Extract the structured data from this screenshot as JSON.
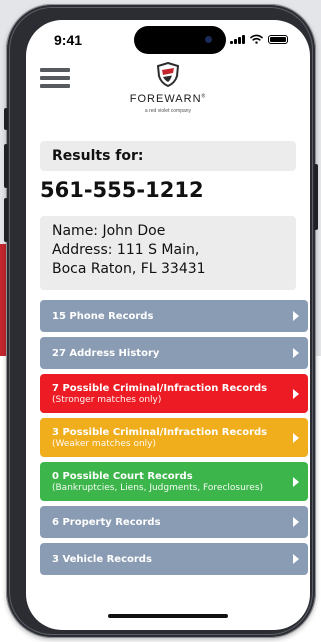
{
  "status_bar": {
    "time": "9:41"
  },
  "brand": {
    "name": "FOREWARN",
    "registered": "®",
    "tagline": "a red violet company",
    "colors": {
      "red": "#c4262e",
      "dark": "#2c2c2c"
    }
  },
  "results": {
    "heading": "Results for:",
    "phone": "561-555-1212",
    "name_line": "Name: John Doe",
    "address_line1": "Address: 111 S Main,",
    "address_line2": "Boca Raton, FL 33431"
  },
  "records": [
    {
      "title": "15 Phone Records",
      "subtitle": "",
      "color": "#8a9cb3"
    },
    {
      "title": "27 Address History",
      "subtitle": "",
      "color": "#8a9cb3"
    },
    {
      "title": "7 Possible Criminal/Infraction Records",
      "subtitle": "(Stronger matches only)",
      "color": "#ed1c24"
    },
    {
      "title": "3 Possible Criminal/Infraction Records",
      "subtitle": "(Weaker matches only)",
      "color": "#f0ad1c"
    },
    {
      "title": "0 Possible Court Records",
      "subtitle": "(Bankruptcies, Liens, Judgments, Foreclosures)",
      "color": "#3cb64a"
    },
    {
      "title": "6 Property Records",
      "subtitle": "",
      "color": "#8a9cb3"
    },
    {
      "title": "3 Vehicle Records",
      "subtitle": "",
      "color": "#8a9cb3"
    }
  ],
  "icons": {
    "menu": "hamburger-icon",
    "signal": "cellular-signal-icon",
    "wifi": "wifi-icon",
    "battery": "battery-icon",
    "arrow": "chevron-right-icon"
  }
}
